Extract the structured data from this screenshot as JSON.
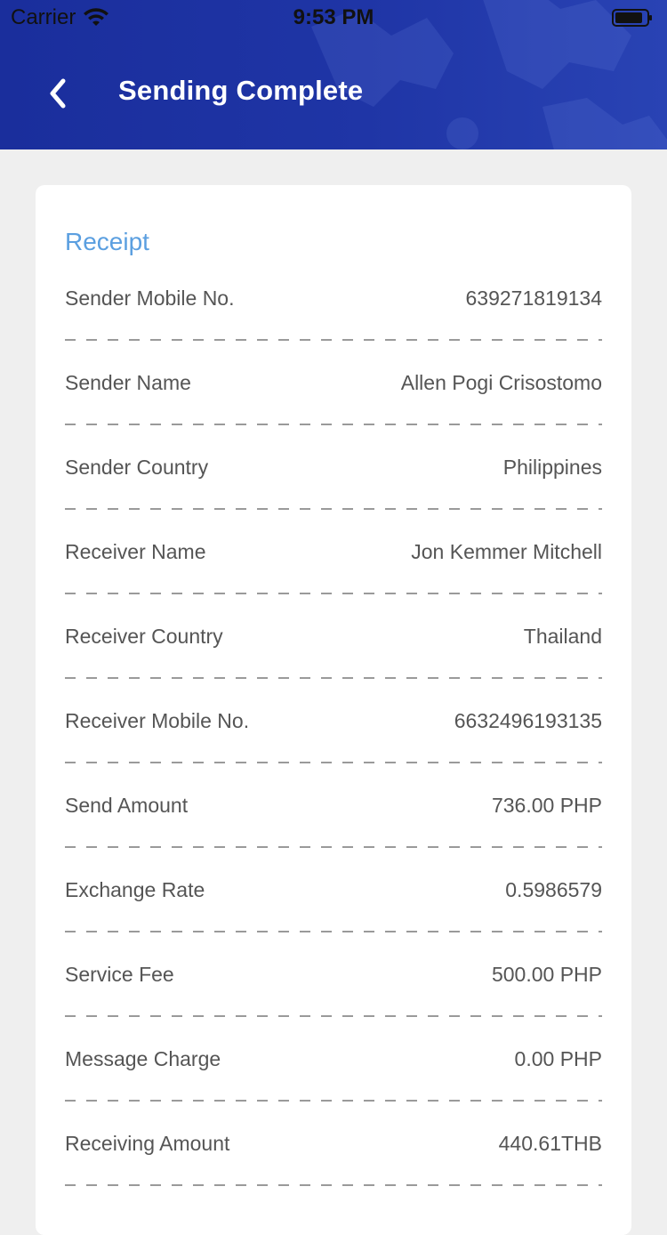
{
  "status_bar": {
    "carrier": "Carrier",
    "time": "9:53 PM"
  },
  "nav": {
    "title": "Sending Complete",
    "back_icon": "chevron-left-icon"
  },
  "colors": {
    "header": "#1f35a6",
    "accent": "#5b9fe0",
    "background": "#efefef",
    "card": "#ffffff",
    "text": "#555555"
  },
  "receipt": {
    "title": "Receipt",
    "rows": [
      {
        "label": "Sender Mobile No.",
        "value": "639271819134"
      },
      {
        "label": "Sender Name",
        "value": "Allen Pogi Crisostomo"
      },
      {
        "label": "Sender Country",
        "value": "Philippines"
      },
      {
        "label": "Receiver Name",
        "value": "Jon Kemmer Mitchell"
      },
      {
        "label": "Receiver Country",
        "value": "Thailand"
      },
      {
        "label": "Receiver Mobile No.",
        "value": "6632496193135"
      },
      {
        "label": "Send Amount",
        "value": "736.00 PHP"
      },
      {
        "label": "Exchange Rate",
        "value": "0.5986579"
      },
      {
        "label": "Service Fee",
        "value": "500.00 PHP"
      },
      {
        "label": "Message Charge",
        "value": "0.00 PHP"
      },
      {
        "label": "Receiving Amount",
        "value": "440.61THB"
      }
    ]
  }
}
